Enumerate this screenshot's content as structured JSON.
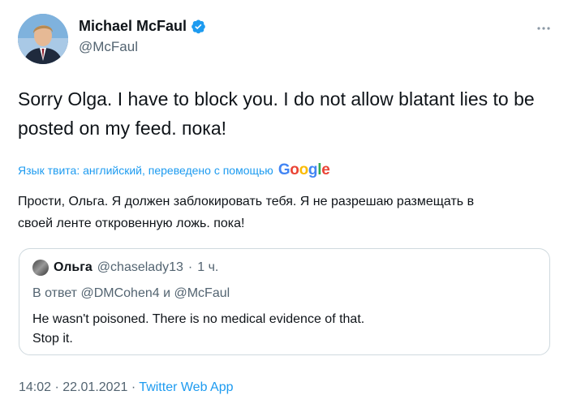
{
  "author": {
    "name": "Michael McFaul",
    "handle": "@McFaul",
    "avatar_icon": "profile-photo",
    "verified_icon": "verified-badge-icon"
  },
  "tweet": {
    "line1": "Sorry Olga. I have to block you. I do not allow blatant lies to be",
    "line2": "posted on my feed.  пока!"
  },
  "translation": {
    "note": "Язык твита: английский, переведено с помощью",
    "provider": "Google",
    "line1": "Прости, Ольга. Я должен заблокировать тебя. Я не разрешаю размещать в",
    "line2": "своей ленте откровенную ложь. пока!"
  },
  "quote": {
    "name": "Ольга",
    "handle": "@chaselady13",
    "time": "1 ч.",
    "reply_prefix": "В ответ",
    "reply_to_1": "@DMCohen4",
    "reply_and": "и",
    "reply_to_2": "@McFaul",
    "line1": "He wasn't poisoned. There is no medical evidence of that.",
    "line2": "Stop it."
  },
  "footer": {
    "time": "14:02",
    "date": "22.01.2021",
    "app": "Twitter Web App"
  },
  "colors": {
    "accent": "#1d9bf0",
    "muted": "#536471",
    "text": "#0f1419",
    "border": "#cfd9de"
  }
}
